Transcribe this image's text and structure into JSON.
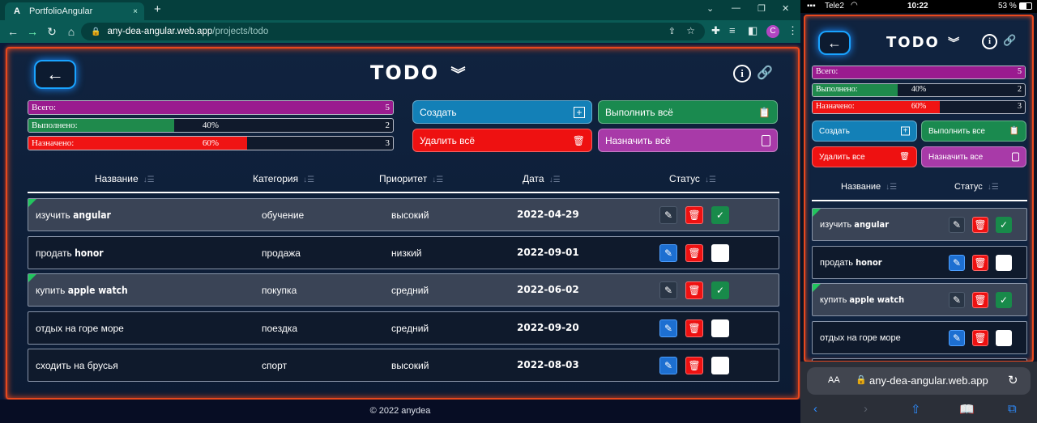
{
  "browser": {
    "tab_title": "PortfolioAngular",
    "tab_close": "×",
    "new_tab": "+",
    "url_host": "any-dea-angular.web.app",
    "url_path": "/projects/todo",
    "avatar_letter": "C",
    "win_minimize": "⌄",
    "win_restore": "—",
    "win_max": "❐",
    "win_close": "✕"
  },
  "app": {
    "title": "TODO",
    "back_icon": "arrow-left-icon",
    "footer": "© 2022 anydea",
    "stats": {
      "total_label": "Всего:",
      "total_count": "5",
      "done_label": "Выполнено:",
      "done_pct": "40%",
      "done_fraction": 0.4,
      "done_count": "2",
      "assigned_label": "Назначено:",
      "assigned_pct": "60%",
      "assigned_fraction": 0.6,
      "assigned_count": "3"
    },
    "actions": {
      "create": "Создать",
      "complete_all": "Выполнить всё",
      "delete_all": "Удалить всё",
      "assign_all": "Назначить всё"
    },
    "columns": {
      "name": "Название",
      "category": "Категория",
      "priority": "Приоритет",
      "date": "Дата",
      "status": "Статус"
    },
    "rows": [
      {
        "name_prefix": "изучить",
        "name_bold": "angular",
        "category": "обучение",
        "priority": "высокий",
        "date": "2022-04-29",
        "done": true
      },
      {
        "name_prefix": "продать",
        "name_bold": "honor",
        "category": "продажа",
        "priority": "низкий",
        "date": "2022-09-01",
        "done": false
      },
      {
        "name_prefix": "купить",
        "name_bold": "apple watch",
        "category": "покупка",
        "priority": "средний",
        "date": "2022-06-02",
        "done": true
      },
      {
        "name_prefix": "отдых на горе море",
        "name_bold": "",
        "category": "поездка",
        "priority": "средний",
        "date": "2022-09-20",
        "done": false
      },
      {
        "name_prefix": "сходить на брусья",
        "name_bold": "",
        "category": "спорт",
        "priority": "высокий",
        "date": "2022-08-03",
        "done": false
      }
    ]
  },
  "phone": {
    "carrier": "Tele2",
    "time": "10:22",
    "battery": "53 %",
    "aa": "AA",
    "url": "any-dea-angular.web.app",
    "actions": {
      "create": "Создать",
      "complete_all": "Выполнить все",
      "delete_all": "Удалить все",
      "assign_all": "Назначить все"
    }
  },
  "colors": {
    "accent_border": "#e8481e",
    "create": "#1380b7",
    "complete": "#1a8a4f",
    "delete": "#ee1111",
    "assign": "#a83aa8",
    "total_bar": "#9a1b8f",
    "done_bar": "#1f8a4c",
    "assigned_bar": "#f01414"
  }
}
